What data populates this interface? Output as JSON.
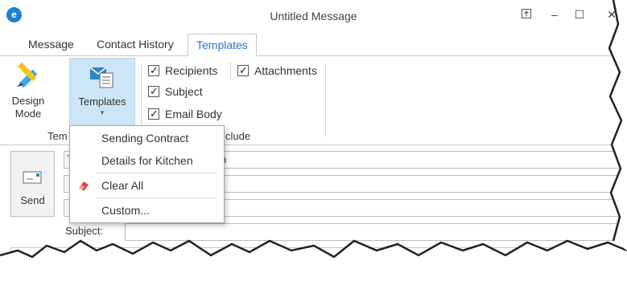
{
  "window": {
    "title": "Untitled Message",
    "logo_text": "e"
  },
  "titlebar_buttons": {
    "pin_icon": "pin-icon",
    "minimize": "–",
    "maximize": "☐",
    "close": "✕"
  },
  "tabs": [
    {
      "label": "Message"
    },
    {
      "label": "Contact History"
    },
    {
      "label": "Templates",
      "active": true
    }
  ],
  "ribbon": {
    "design_mode": "Design Mode",
    "templates": "Templates",
    "group_templates": "Tem",
    "group_include": "clude",
    "checks": [
      {
        "label": "Recipients",
        "checked": true
      },
      {
        "label": "Subject",
        "checked": true
      },
      {
        "label": "Email Body",
        "checked": true
      },
      {
        "label": "Attachments",
        "checked": true
      }
    ]
  },
  "menu": {
    "items": [
      {
        "label": "Sending Contract"
      },
      {
        "label": "Details for Kitchen"
      },
      {
        "label": "Clear All",
        "icon": "eraser-icon"
      },
      {
        "label": "Custom..."
      }
    ]
  },
  "compose": {
    "send": "Send",
    "subject_label": "Subject:",
    "partial_field_text": "n",
    "partial_btn_text": "T"
  },
  "colors": {
    "accent": "#2a78c8",
    "selected_bg": "#cde6f7",
    "logo": "#1a7fd6"
  }
}
